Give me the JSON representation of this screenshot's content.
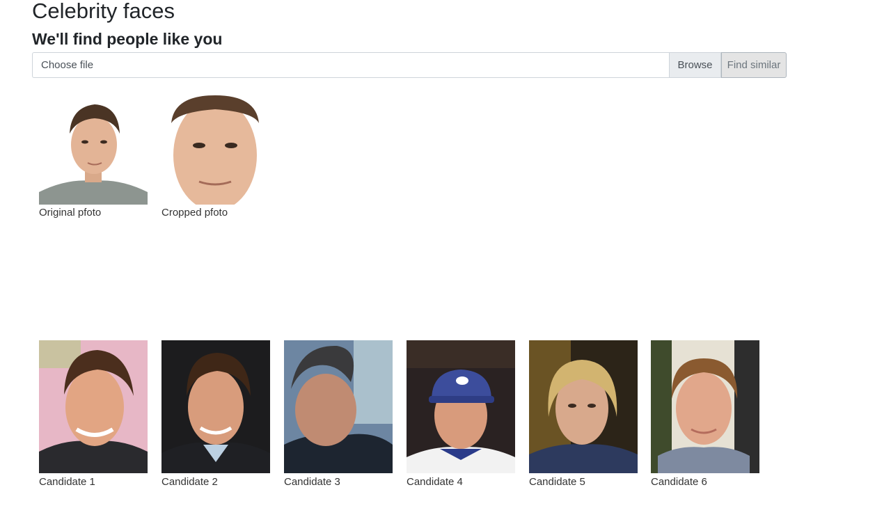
{
  "header": {
    "title": "Celebrity faces",
    "subtitle": "We'll find people like you"
  },
  "upload": {
    "placeholder": "Choose file",
    "browse_label": "Browse",
    "find_label": "Find similar"
  },
  "input_photos": [
    {
      "caption": "Original pfoto"
    },
    {
      "caption": "Cropped pfoto"
    }
  ],
  "candidates": [
    {
      "caption": "Candidate 1"
    },
    {
      "caption": "Candidate 2"
    },
    {
      "caption": "Candidate 3"
    },
    {
      "caption": "Candidate 4"
    },
    {
      "caption": "Candidate 5"
    },
    {
      "caption": "Candidate 6"
    }
  ],
  "colors": {
    "button_bg": "#e9ecef",
    "border": "#ced4da",
    "text": "#212529"
  }
}
